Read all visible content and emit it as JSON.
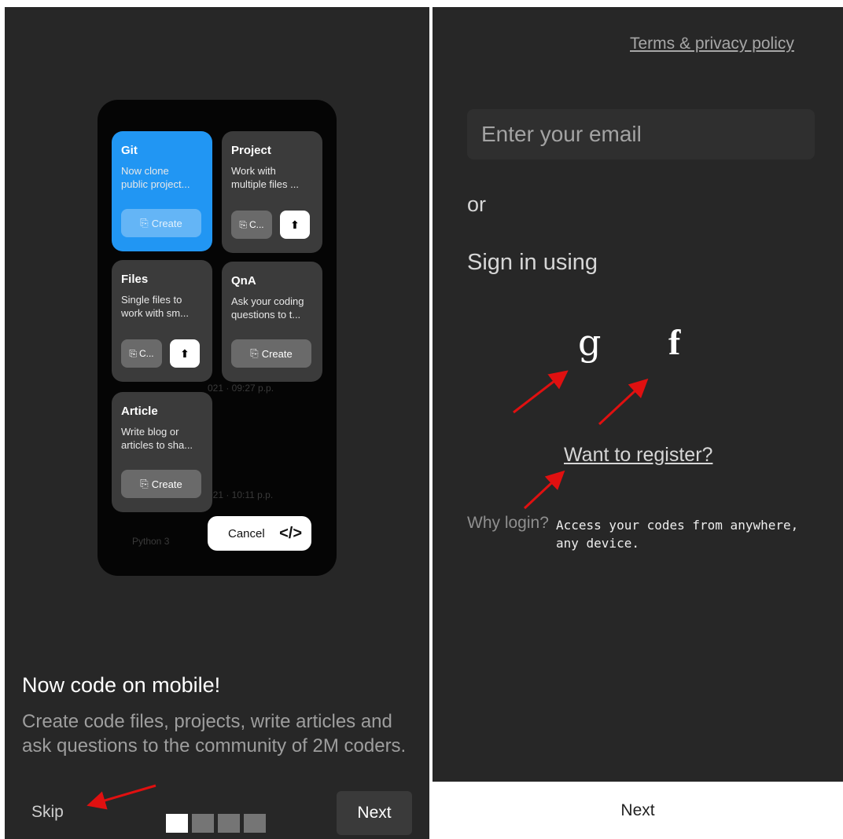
{
  "onboarding": {
    "cards": {
      "git": {
        "title": "Git",
        "desc1": "Now clone",
        "desc2": "public project...",
        "create": "Create"
      },
      "project": {
        "title": "Project",
        "desc1": "Work with",
        "desc2": "multiple files ...",
        "create_short": "C..."
      },
      "files": {
        "title": "Files",
        "desc1": "Single files to",
        "desc2": "work with sm...",
        "create_short": "C..."
      },
      "qna": {
        "title": "QnA",
        "desc1": "Ask your coding",
        "desc2": "questions to t...",
        "create": "Create"
      },
      "article": {
        "title": "Article",
        "desc1": "Write blog or",
        "desc2": "articles to sha...",
        "create": "Create"
      }
    },
    "background": {
      "time1": "021 · 09:27 p.p.",
      "time2": "021 · 10:11 p.p.",
      "file_label": "Python 3"
    },
    "cancel_label": "Cancel",
    "code_icon": "</>",
    "title": "Now code on mobile!",
    "description": "Create code files, projects, write articles and ask questions to the community of 2M coders.",
    "skip_label": "Skip",
    "next_label": "Next",
    "pages": 4,
    "current_page": 1
  },
  "login": {
    "terms_label": "Terms & privacy policy",
    "email_placeholder": "Enter your email",
    "or_label": "or",
    "signin_label": "Sign in using",
    "google_glyph": "g",
    "facebook_glyph": "f",
    "register_label": "Want to register?",
    "why_label": "Why login?",
    "why_text": "Access your codes from anywhere, any device.",
    "next_label": "Next"
  },
  "colors": {
    "accent_blue": "#2196f3",
    "annotation_red": "#e01010",
    "panel_bg": "#272727"
  }
}
